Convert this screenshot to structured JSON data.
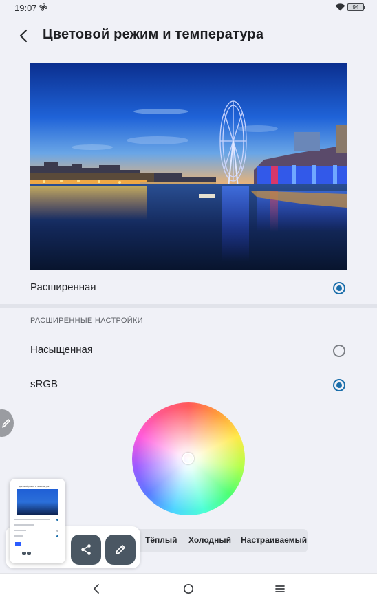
{
  "status": {
    "time": "19:07",
    "battery": "94"
  },
  "header": {
    "title": "Цветовой режим и температура"
  },
  "preview": {
    "image": "london-eye-night-photo"
  },
  "options": [
    {
      "label": "Расширенная",
      "selected": true
    },
    {
      "label": "Насыщенная",
      "selected": false
    },
    {
      "label": "sRGB",
      "selected": true
    }
  ],
  "section": {
    "title": "РАСШИРЕННЫЕ НАСТРОЙКИ"
  },
  "temperature": {
    "tabs": [
      "Тёплый",
      "Холодный",
      "Настраиваемый"
    ]
  },
  "screenshot_tools": {
    "share_icon": "share-icon",
    "edit_icon": "pencil-icon"
  },
  "colors": {
    "accent": "#1a6eaa",
    "background": "#f0f1f7",
    "tool_button": "#4a5763"
  }
}
